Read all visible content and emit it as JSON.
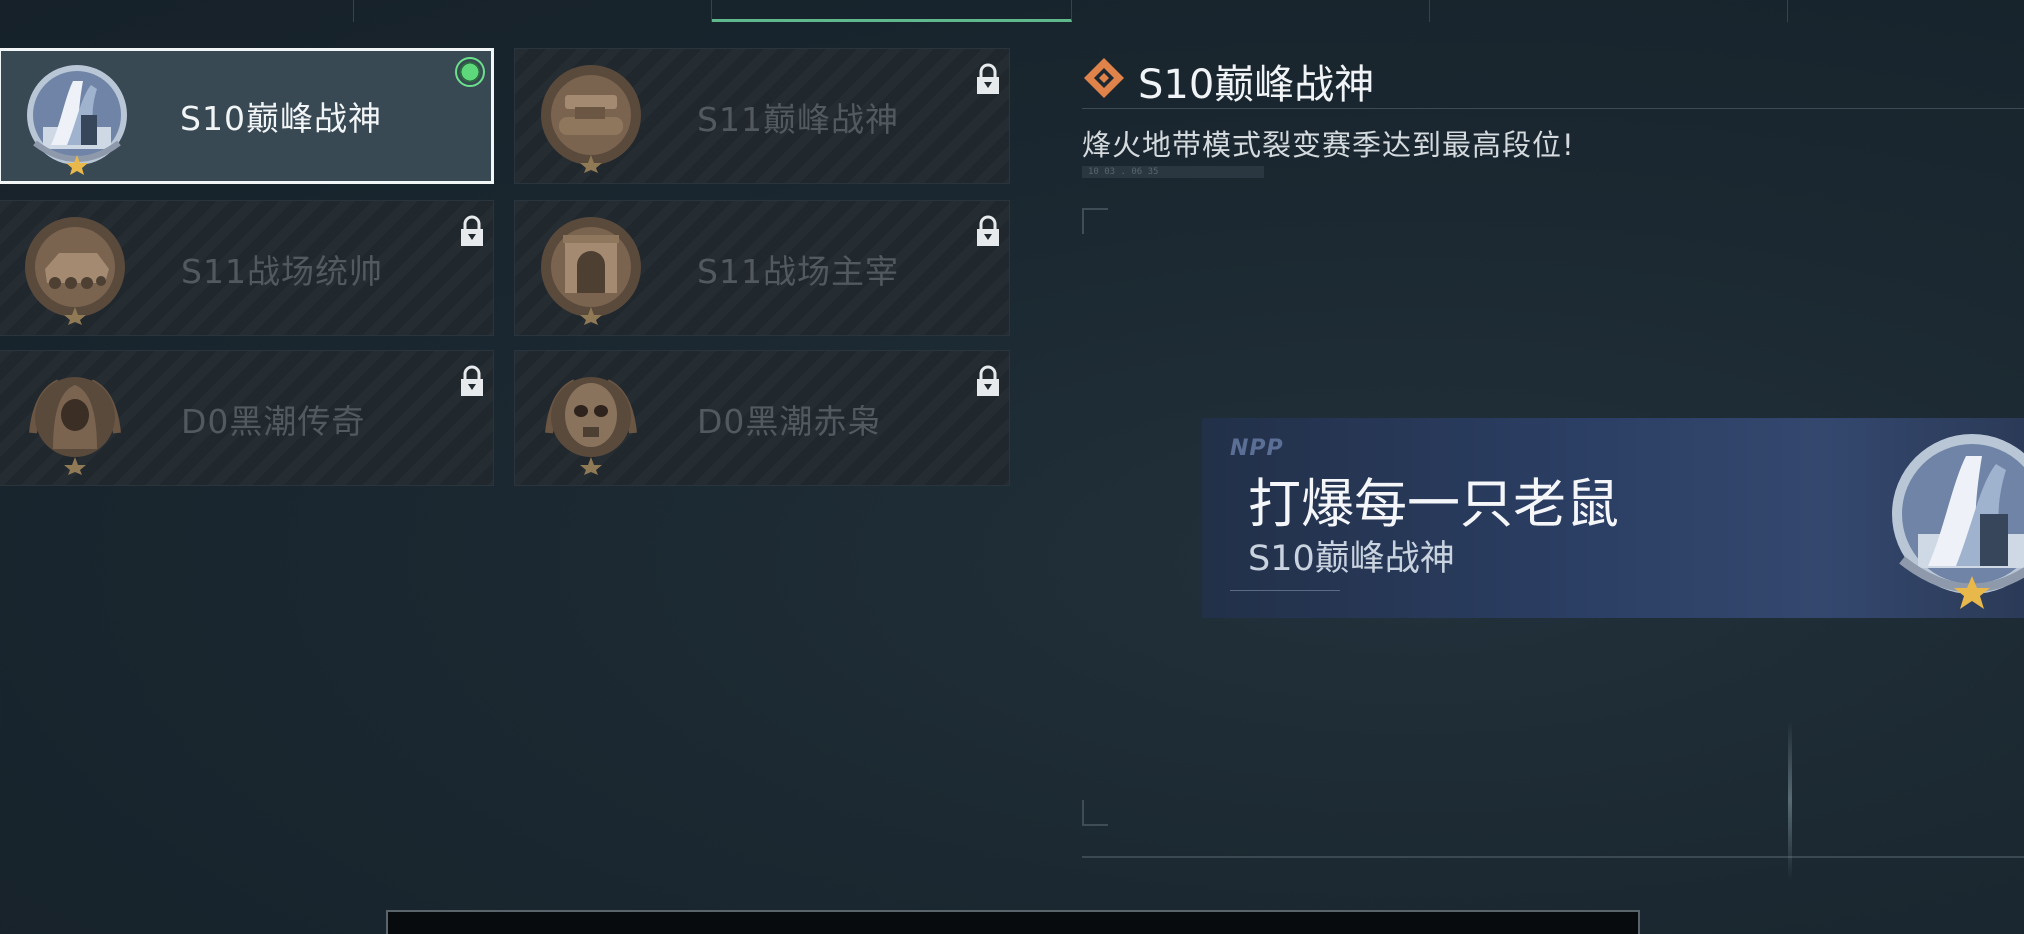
{
  "tabs": [
    {
      "name": "tab-1",
      "active": false
    },
    {
      "name": "tab-2",
      "active": false
    },
    {
      "name": "tab-3",
      "active": true
    },
    {
      "name": "tab-4",
      "active": false
    },
    {
      "name": "tab-5",
      "active": false
    }
  ],
  "badges": [
    {
      "label": "S10巅峰战神",
      "locked": false,
      "selected": true,
      "equipped": true,
      "icon": "summit-medal-icon"
    },
    {
      "label": "S11巅峰战神",
      "locked": true,
      "selected": false,
      "equipped": false,
      "icon": "tank-medal-icon"
    },
    {
      "label": "S11战场统帅",
      "locked": true,
      "selected": false,
      "equipped": false,
      "icon": "apc-medal-icon"
    },
    {
      "label": "S11战场主宰",
      "locked": true,
      "selected": false,
      "equipped": false,
      "icon": "arch-medal-icon"
    },
    {
      "label": "D0黑潮传奇",
      "locked": true,
      "selected": false,
      "equipped": false,
      "icon": "hooded-figure-medal-icon"
    },
    {
      "label": "D0黑潮赤枭",
      "locked": true,
      "selected": false,
      "equipped": false,
      "icon": "skull-mask-medal-icon"
    }
  ],
  "detail": {
    "title": "S10巅峰战神",
    "description": "烽火地带模式裂变赛季达到最高段位!",
    "meta": "10 03 . 06 35",
    "icon": "orange-diamond-icon"
  },
  "namecard": {
    "brand": "NPP",
    "title": "打爆每一只老鼠",
    "subtitle": "S10巅峰战神"
  },
  "colors": {
    "accent_green": "#5fb98c",
    "equipped": "#5dd97b",
    "diamond": "#e0834a",
    "locked_text": "#52595f",
    "star": "#e8b84a"
  }
}
